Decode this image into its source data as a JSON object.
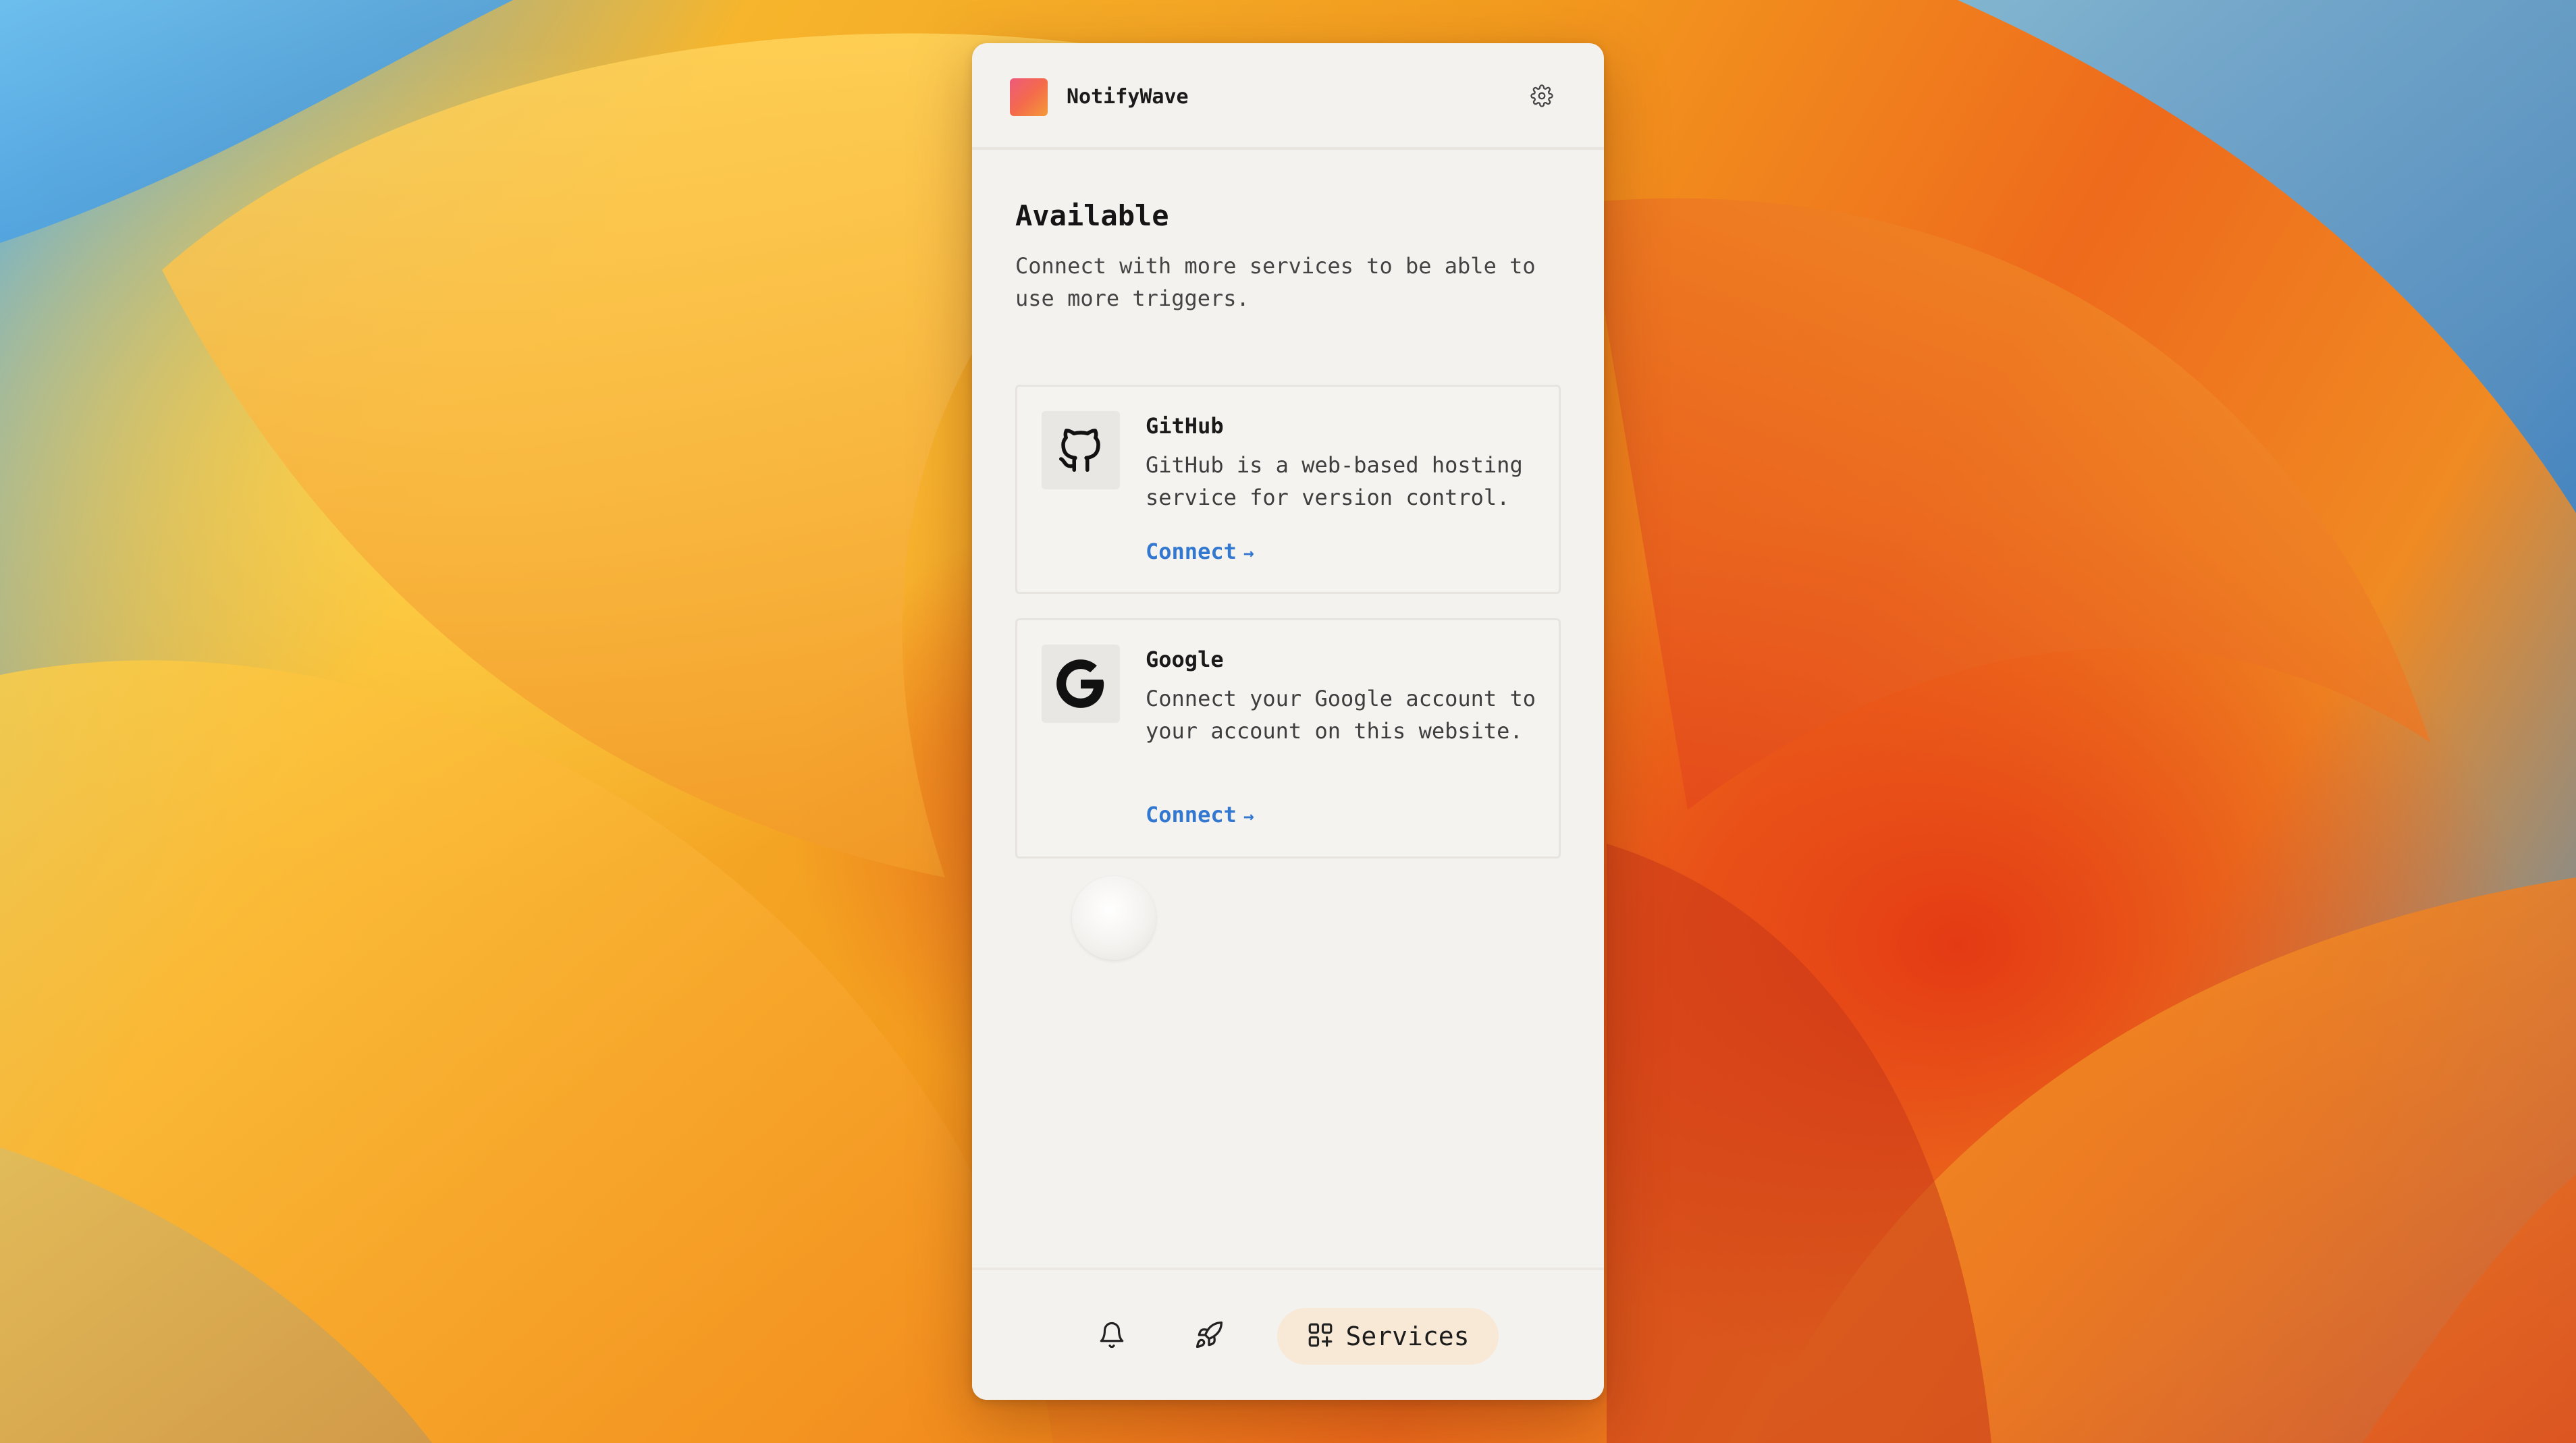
{
  "app": {
    "name": "NotifyWave",
    "logo_gradient": [
      "#ee5a7c",
      "#f59a38"
    ]
  },
  "header": {
    "settings_icon": "gear-icon"
  },
  "available": {
    "title": "Available",
    "description": "Connect with more services to be able to use more triggers."
  },
  "services": [
    {
      "name": "GitHub",
      "icon": "github-icon",
      "description": "GitHub is a web-based hosting service for version control.",
      "action_label": "Connect",
      "action_arrow": "→"
    },
    {
      "name": "Google",
      "icon": "google-icon",
      "description": "Connect your Google account to your account on this website.",
      "action_label": "Connect",
      "action_arrow": "→"
    }
  ],
  "nav": {
    "items": [
      {
        "icon": "bell-icon",
        "label": "",
        "active": false
      },
      {
        "icon": "rocket-icon",
        "label": "",
        "active": false
      },
      {
        "icon": "apps-add-icon",
        "label": "Services",
        "active": true
      }
    ]
  },
  "colors": {
    "link": "#3277d0",
    "active_tab_bg": "#f8e9d6",
    "panel_bg": "#f4f2ef"
  }
}
